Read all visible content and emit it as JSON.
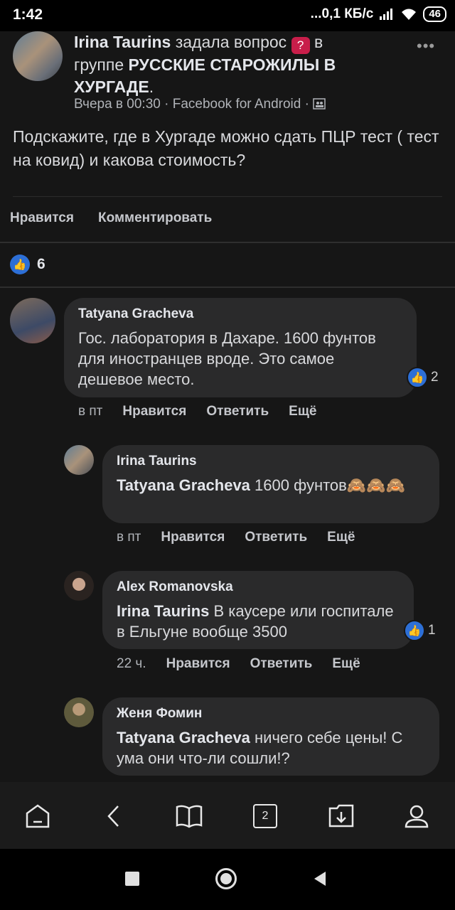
{
  "status_bar": {
    "time": "1:42",
    "network": "...0,1 КБ/с",
    "signal_icon": "signal-icon",
    "wifi_icon": "wifi-icon",
    "battery": "46"
  },
  "post": {
    "author": "Irina Taurins",
    "action": "задала вопрос",
    "in_word": "в",
    "group_prefix": "группе",
    "group_name": "РУССКИЕ СТАРОЖИЛЫ В ХУРГАДЕ",
    "period": ".",
    "meta": "Вчера в 00:30 · Facebook for Android ·",
    "text": "Подскажите, где в Хургаде можно сдать ПЦР тест ( тест на ковид) и какова стоимость?",
    "like_label": "Нравится",
    "comment_label": "Комментировать",
    "reactions_count": "6"
  },
  "comments": [
    {
      "name": "Tatyana Gracheva",
      "mention": "",
      "text": "Гос. лаборатория в Дахаре. 1600 фунтов для иностранцев вроде. Это самое дешевое место.",
      "time": "в пт",
      "like": "Нравится",
      "reply": "Ответить",
      "more": "Ещё",
      "reactions": "2"
    },
    {
      "name": "Irina Taurins",
      "mention": "Tatyana Gracheva",
      "text": " 1600 фунтов🙈🙈🙈",
      "time": "в пт",
      "like": "Нравится",
      "reply": "Ответить",
      "more": "Ещё",
      "reactions": ""
    },
    {
      "name": "Alex Romanovska",
      "mention": "Irina Taurins",
      "text": " В каусере или госпитале в Ельгуне вообще 3500",
      "time": "22 ч.",
      "like": "Нравится",
      "reply": "Ответить",
      "more": "Ещё",
      "reactions": "1"
    },
    {
      "name": "Женя Фомин",
      "mention": "Tatyana Gracheva",
      "text": " ничего себе цены! С ума они что-ли сошли!?",
      "time": "",
      "like": "",
      "reply": "",
      "more": "",
      "reactions": ""
    }
  ],
  "bottom_nav": {
    "home_icon": "home-icon",
    "back_icon": "back-icon",
    "book_icon": "book-icon",
    "tabs_count": "2",
    "download_icon": "download-icon",
    "profile_icon": "profile-icon"
  },
  "system_nav": {
    "recents_icon": "recents-icon",
    "home_icon": "home-circle-icon",
    "back_icon": "back-triangle-icon"
  }
}
